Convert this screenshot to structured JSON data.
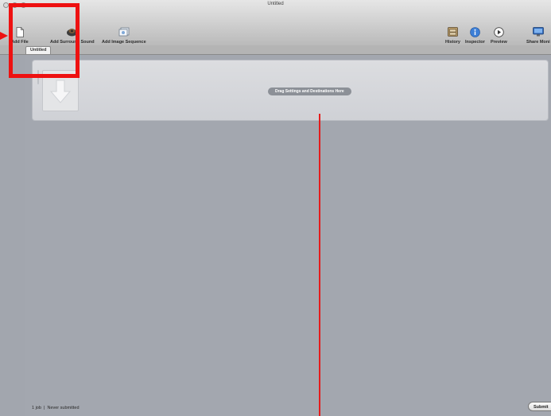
{
  "window": {
    "title": "Untitled"
  },
  "toolbar": {
    "left_items": [
      {
        "id": "add-file",
        "label": "Add File",
        "icon": "file-icon"
      },
      {
        "id": "add-surround-sound",
        "label": "Add Surround Sound",
        "icon": "speaker-icon"
      },
      {
        "id": "add-image-sequence",
        "label": "Add Image Sequence",
        "icon": "image-sequence-icon"
      }
    ],
    "right_items": [
      {
        "id": "history",
        "label": "History",
        "icon": "history-drawer-icon"
      },
      {
        "id": "inspector",
        "label": "Inspector",
        "icon": "info-icon"
      },
      {
        "id": "preview",
        "label": "Preview",
        "icon": "play-icon"
      },
      {
        "id": "share-monitor",
        "label": "Share Moni",
        "icon": "monitor-icon"
      }
    ]
  },
  "tabs": [
    {
      "label": "Untitled",
      "active": true
    }
  ],
  "batch": {
    "drop_hint": "Drag Settings and Destinations Here"
  },
  "status": {
    "text": "1 job  |  Never submitted",
    "submit_label": "Submit"
  },
  "annotations": {
    "color": "#ee1111"
  }
}
